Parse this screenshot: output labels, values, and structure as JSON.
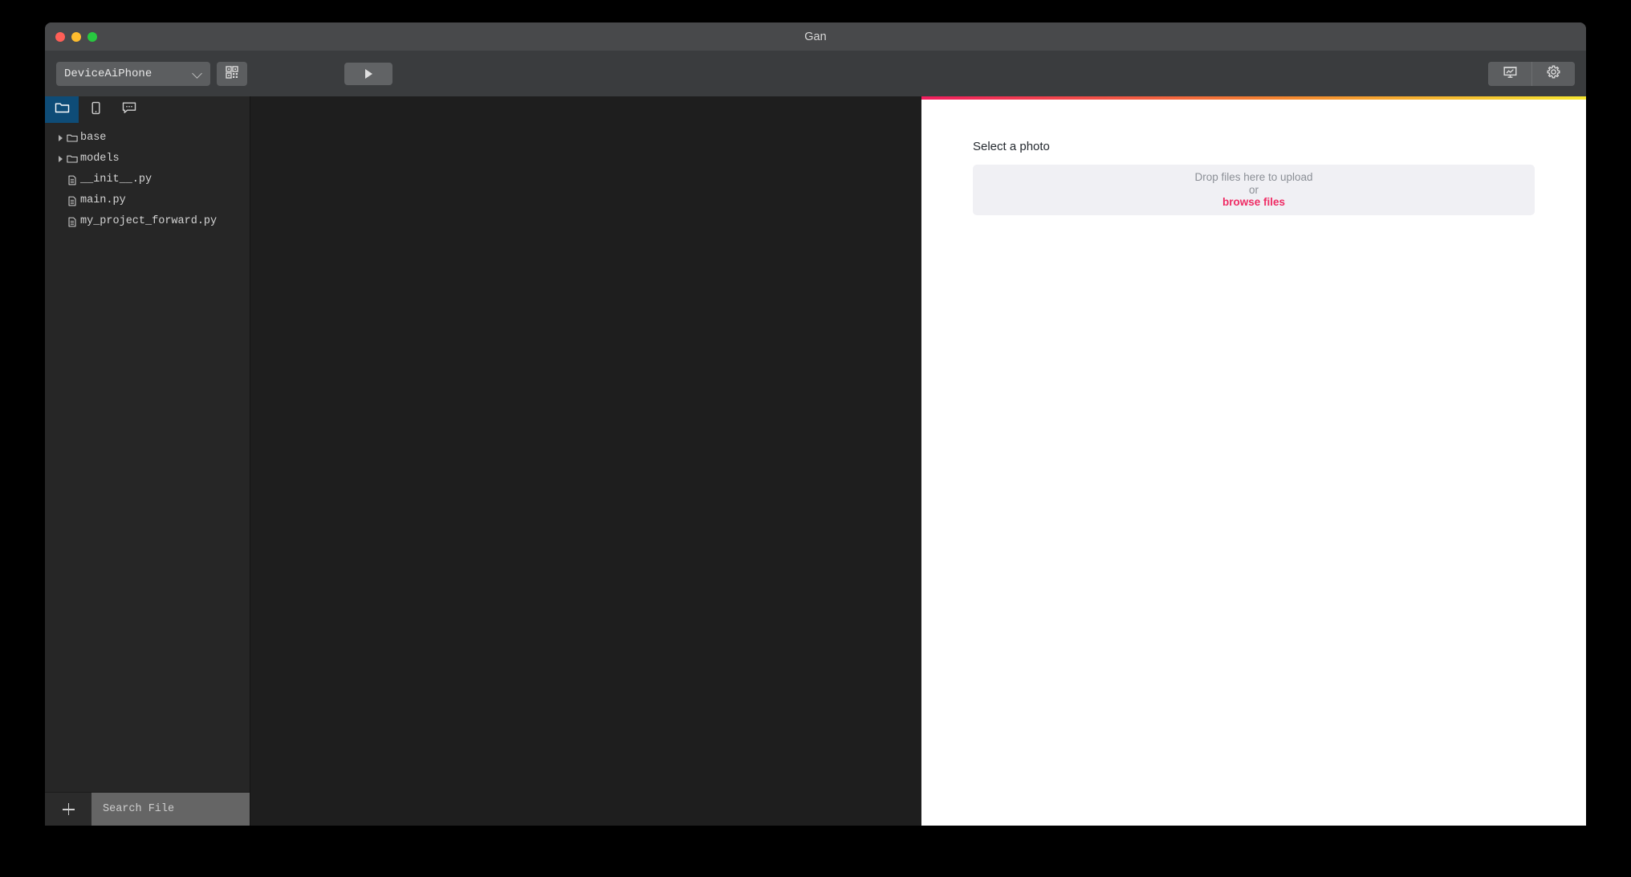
{
  "window": {
    "title": "Gan",
    "traffic_lights": [
      "close",
      "minimize",
      "maximize"
    ]
  },
  "toolbar": {
    "device_select_value": "DeviceAiPhone",
    "qr_button_icon": "qr-code-icon",
    "run_button_icon": "play-icon",
    "right_buttons": [
      {
        "icon": "presentation-chart-icon"
      },
      {
        "icon": "gear-icon"
      }
    ]
  },
  "sidebar": {
    "tabs": [
      {
        "id": "files",
        "icon": "folder-icon",
        "active": true
      },
      {
        "id": "device",
        "icon": "mobile-device-icon",
        "active": false
      },
      {
        "id": "chat",
        "icon": "chat-bubble-icon",
        "active": false
      }
    ],
    "tree": [
      {
        "label": "base",
        "type": "folder",
        "expanded": false
      },
      {
        "label": "models",
        "type": "folder",
        "expanded": false
      },
      {
        "label": "__init__.py",
        "type": "file"
      },
      {
        "label": "main.py",
        "type": "file"
      },
      {
        "label": "my_project_forward.py",
        "type": "file"
      }
    ],
    "add_button_icon": "plus-icon",
    "search_placeholder": "Search File",
    "search_value": ""
  },
  "preview": {
    "accent_gradient": [
      "#f01d5e",
      "#f5872f",
      "#f7e730"
    ],
    "upload_label": "Select a photo",
    "dropzone": {
      "line1": "Drop files here to upload",
      "line2": "or",
      "browse_label": "browse files",
      "browse_color": "#ef2b64"
    }
  }
}
